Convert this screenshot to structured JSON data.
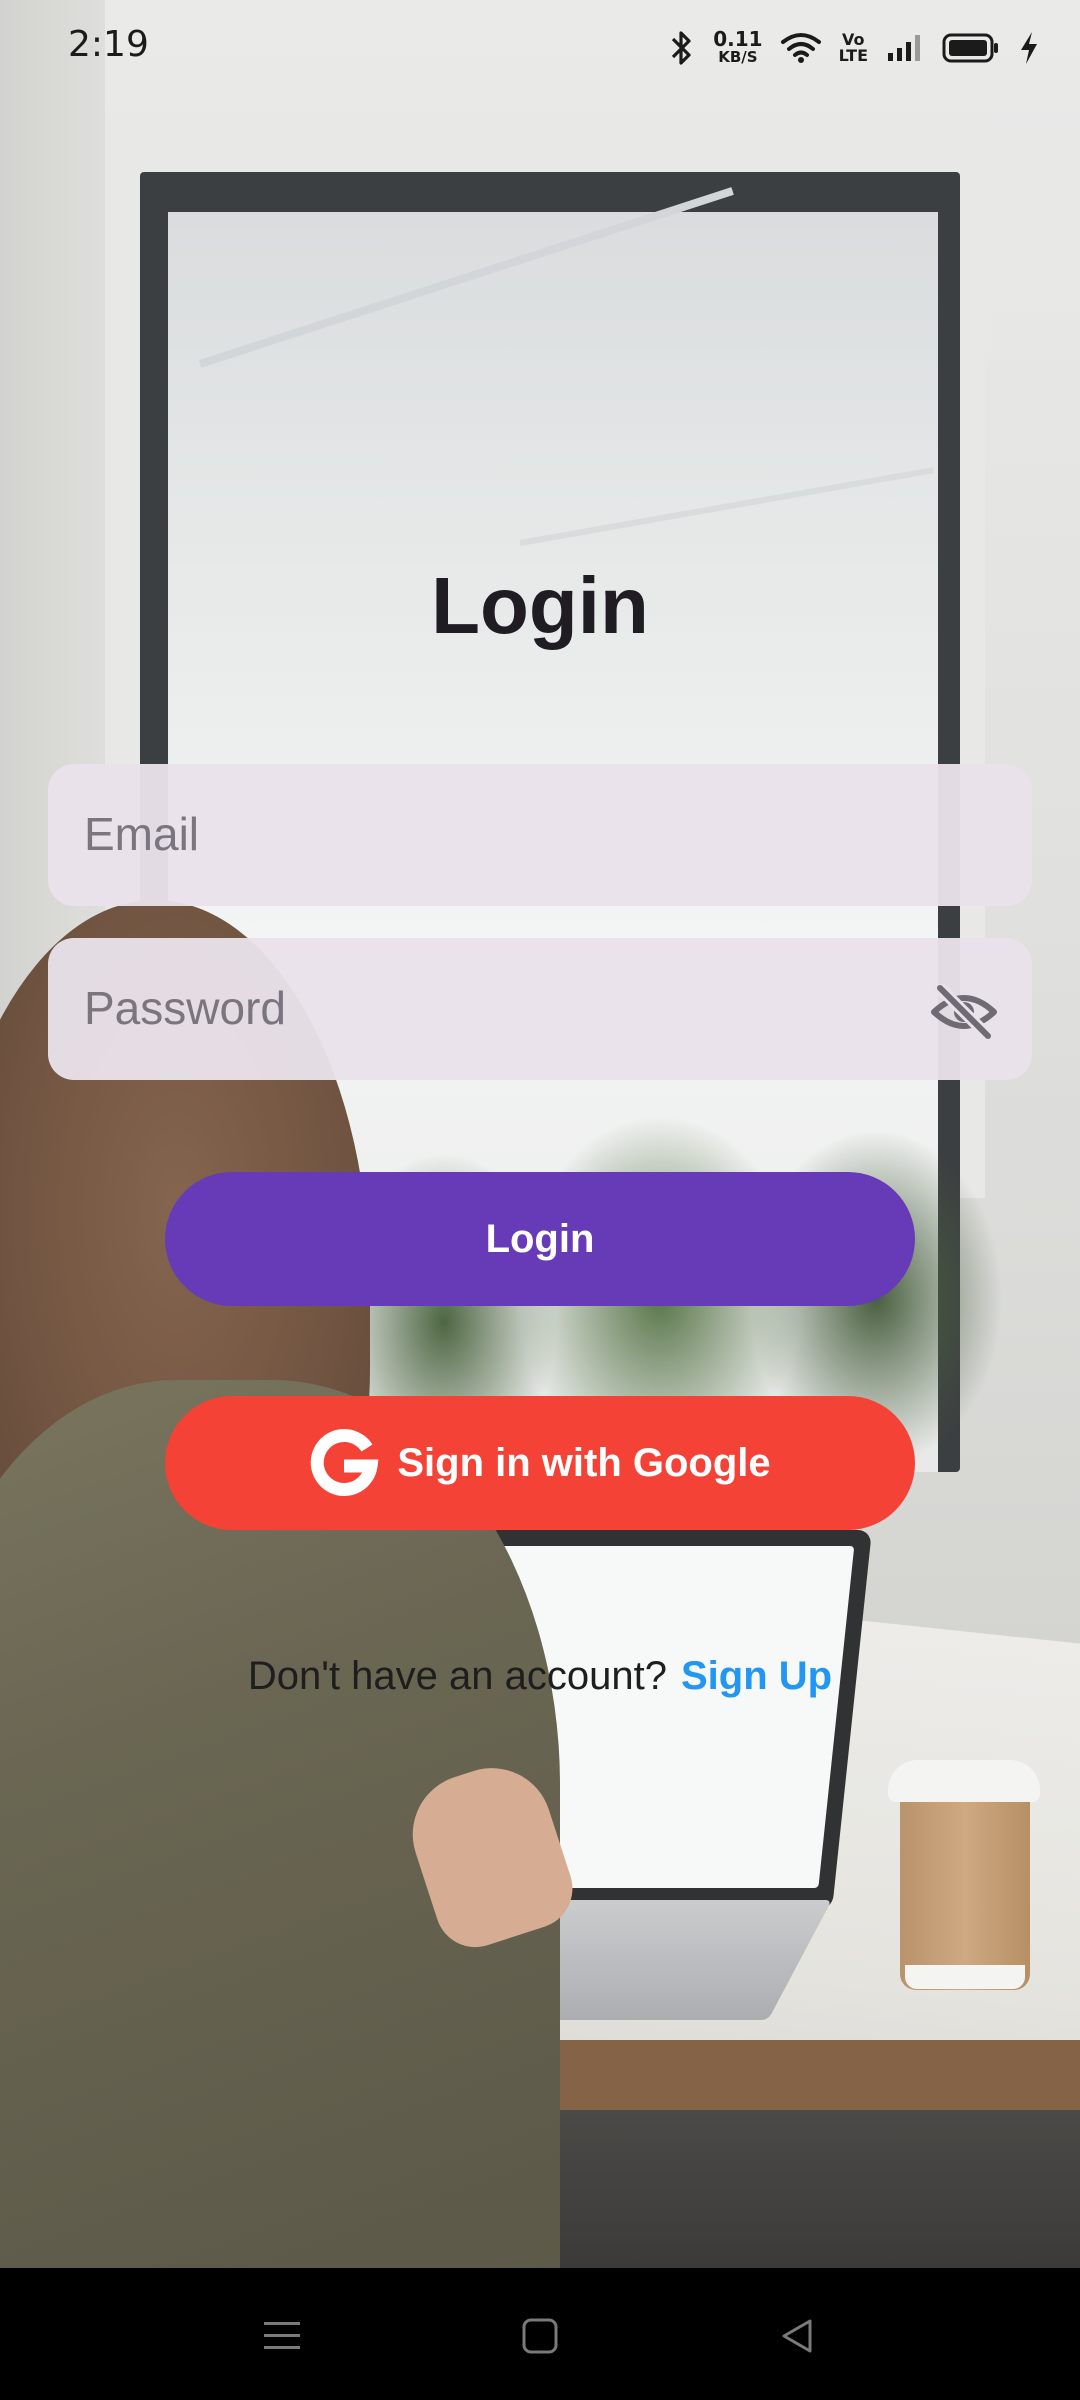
{
  "status_bar": {
    "time": "2:19",
    "net_speed_value": "0.11",
    "net_speed_unit": "KB/S",
    "volte_top": "Vo",
    "volte_bottom": "LTE",
    "icons": [
      "bluetooth-icon",
      "wifi-icon",
      "signal-icon",
      "battery-icon",
      "charging-icon"
    ]
  },
  "login": {
    "title": "Login",
    "email_placeholder": "Email",
    "password_placeholder": "Password",
    "login_button_label": "Login",
    "google_button_label": "Sign in with Google",
    "signup_prompt": "Don't have an account?",
    "signup_link": "Sign Up"
  },
  "colors": {
    "primary": "#673ab7",
    "google": "#f44336",
    "link": "#2196f3",
    "field_bg": "#e9e2ea"
  },
  "nav_bar": {
    "icons": [
      "menu-icon",
      "home-icon",
      "back-icon"
    ]
  }
}
